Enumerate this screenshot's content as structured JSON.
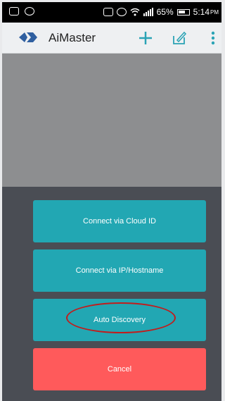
{
  "status_bar": {
    "battery_percent": "65%",
    "time": "5:14",
    "ampm": "PM"
  },
  "app_bar": {
    "title": "AiMaster",
    "actions": [
      "add-icon",
      "edit-icon",
      "more-vert-icon"
    ]
  },
  "connect_sheet": {
    "cloud_id_label": "Connect via Cloud ID",
    "ip_hostname_label": "Connect via IP/Hostname",
    "auto_discovery_label": "Auto Discovery",
    "cancel_label": "Cancel"
  },
  "colors": {
    "teal_button": "#22a7b3",
    "cancel_button": "#ff5a5b",
    "sheet_background": "#4a4d54",
    "highlight_circle": "#c21c1c"
  }
}
